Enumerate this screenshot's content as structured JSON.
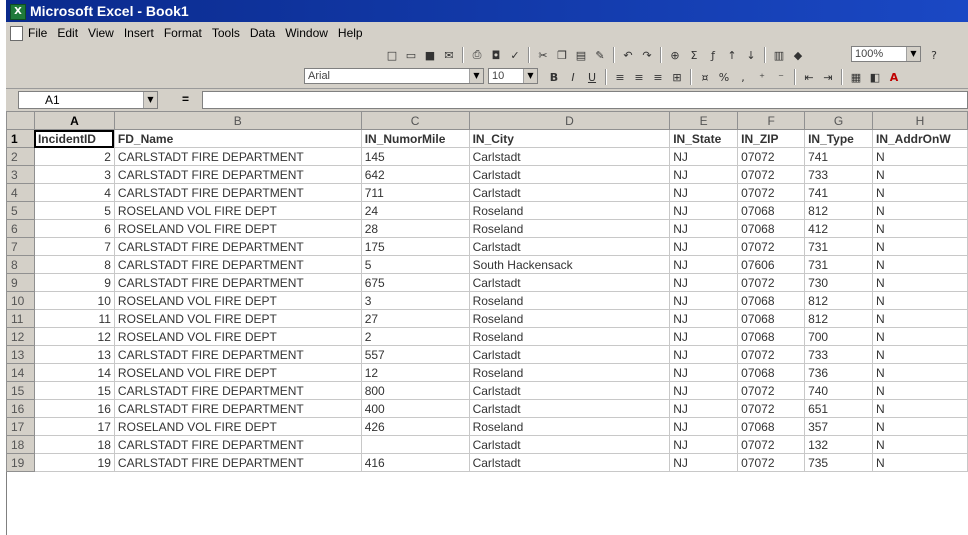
{
  "window": {
    "title": "Microsoft Excel - Book1",
    "app_icon": "excel-icon"
  },
  "menu": [
    "File",
    "Edit",
    "View",
    "Insert",
    "Format",
    "Tools",
    "Data",
    "Window",
    "Help"
  ],
  "toolbar": {
    "zoom": "100%",
    "font_name": "Arial",
    "font_size": "10"
  },
  "formula_bar": {
    "name_box": "A1",
    "equals": "=",
    "formula": ""
  },
  "sheet": {
    "columns": [
      "A",
      "B",
      "C",
      "D",
      "E",
      "F",
      "G",
      "H"
    ],
    "rows": [
      [
        "1",
        "IncidentID",
        "FD_Name",
        "IN_NumorMile",
        "IN_City",
        "IN_State",
        "IN_ZIP",
        "IN_Type",
        "IN_AddrOnW"
      ],
      [
        "2",
        "2",
        "CARLSTADT FIRE DEPARTMENT",
        "145",
        "Carlstadt",
        "NJ",
        "07072",
        "741",
        "N"
      ],
      [
        "3",
        "3",
        "CARLSTADT FIRE DEPARTMENT",
        "642",
        "Carlstadt",
        "NJ",
        "07072",
        "733",
        "N"
      ],
      [
        "4",
        "4",
        "CARLSTADT FIRE DEPARTMENT",
        "711",
        "Carlstadt",
        "NJ",
        "07072",
        "741",
        "N"
      ],
      [
        "5",
        "5",
        "ROSELAND VOL FIRE DEPT",
        "24",
        "Roseland",
        "NJ",
        "07068",
        "812",
        "N"
      ],
      [
        "6",
        "6",
        "ROSELAND VOL FIRE DEPT",
        "28",
        "Roseland",
        "NJ",
        "07068",
        "412",
        "N"
      ],
      [
        "7",
        "7",
        "CARLSTADT FIRE DEPARTMENT",
        "175",
        "Carlstadt",
        "NJ",
        "07072",
        "731",
        "N"
      ],
      [
        "8",
        "8",
        "CARLSTADT FIRE DEPARTMENT",
        "5",
        "South Hackensack",
        "NJ",
        "07606",
        "731",
        "N"
      ],
      [
        "9",
        "9",
        "CARLSTADT FIRE DEPARTMENT",
        "675",
        "Carlstadt",
        "NJ",
        "07072",
        "730",
        "N"
      ],
      [
        "10",
        "10",
        "ROSELAND VOL FIRE DEPT",
        "3",
        "Roseland",
        "NJ",
        "07068",
        "812",
        "N"
      ],
      [
        "11",
        "11",
        "ROSELAND VOL FIRE DEPT",
        "27",
        "Roseland",
        "NJ",
        "07068",
        "812",
        "N"
      ],
      [
        "12",
        "12",
        "ROSELAND VOL FIRE DEPT",
        "2",
        "Roseland",
        "NJ",
        "07068",
        "700",
        "N"
      ],
      [
        "13",
        "13",
        "CARLSTADT FIRE DEPARTMENT",
        "557",
        "Carlstadt",
        "NJ",
        "07072",
        "733",
        "N"
      ],
      [
        "14",
        "14",
        "ROSELAND VOL FIRE DEPT",
        "12",
        "Roseland",
        "NJ",
        "07068",
        "736",
        "N"
      ],
      [
        "15",
        "15",
        "CARLSTADT FIRE DEPARTMENT",
        "800",
        "Carlstadt",
        "NJ",
        "07072",
        "740",
        "N"
      ],
      [
        "16",
        "16",
        "CARLSTADT FIRE DEPARTMENT",
        "400",
        "Carlstadt",
        "NJ",
        "07072",
        "651",
        "N"
      ],
      [
        "17",
        "17",
        "ROSELAND VOL FIRE DEPT",
        "426",
        "Roseland",
        "NJ",
        "07068",
        "357",
        "N"
      ],
      [
        "18",
        "18",
        "CARLSTADT FIRE DEPARTMENT",
        "",
        "Carlstadt",
        "NJ",
        "07072",
        "132",
        "N"
      ],
      [
        "19",
        "19",
        "CARLSTADT FIRE DEPARTMENT",
        "416",
        "Carlstadt",
        "NJ",
        "07072",
        "735",
        "N"
      ]
    ]
  }
}
